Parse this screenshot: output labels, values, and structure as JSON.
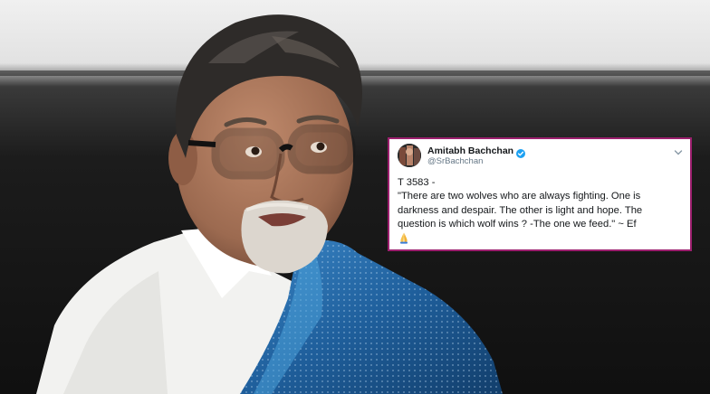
{
  "photo": {
    "subject": "portrait-photo",
    "colors": {
      "backdrop_top": "#eeeeee",
      "backdrop_dark": "#181818",
      "shirt": "#f4f4f2",
      "shawl": "#1f5f9c",
      "shawl_light": "#3a86c6",
      "skin": "#a9765a",
      "hair": "#2e2b29",
      "beard": "#dcd6ce"
    }
  },
  "tweet": {
    "border_color": "#9c1f6e",
    "display_name": "Amitabh Bachchan",
    "handle": "@SrBachchan",
    "verified_icon": "verified-badge-icon",
    "menu_icon": "chevron-down-icon",
    "lines": {
      "l1": "T 3583 -",
      "l2": "\"There are two wolves who are always fighting. One is",
      "l3": "darkness and despair. The other is light and hope. The",
      "l4": "question is which wolf wins ? -The one we feed.\" ~ Ef"
    },
    "emoji_icon": "folded-hands-icon"
  }
}
